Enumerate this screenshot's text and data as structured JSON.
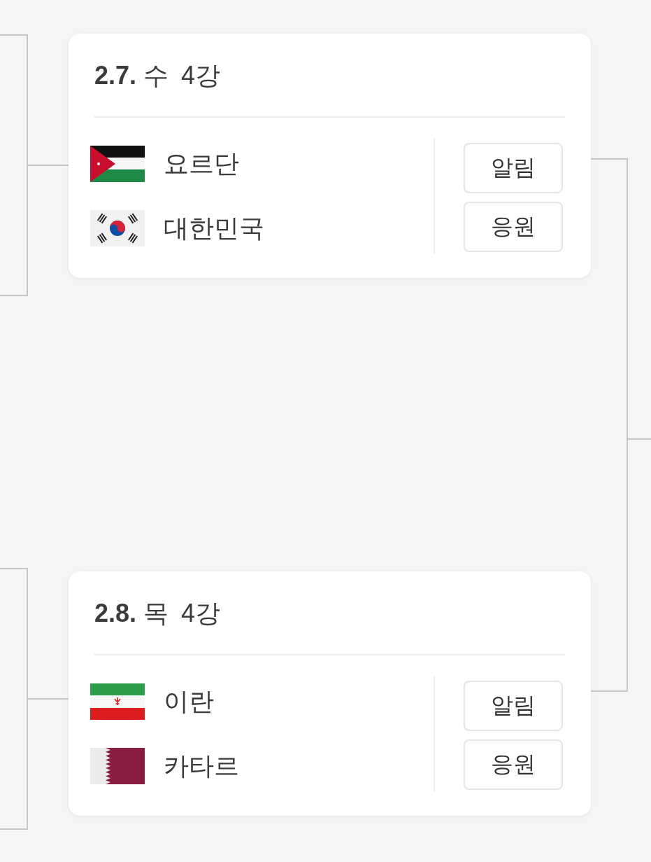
{
  "matches": [
    {
      "date": "**2.7.** 수",
      "round": "4강",
      "teams": [
        {
          "name": "요르단",
          "kind": "jordan"
        },
        {
          "name": "대한민국",
          "kind": "korea"
        }
      ],
      "buttons": [
        "알림",
        "응원"
      ]
    },
    {
      "date": "**2.8.** 목",
      "round": "4강",
      "teams": [
        {
          "name": "이란",
          "kind": "iran"
        },
        {
          "name": "카타르",
          "kind": "qatar"
        }
      ],
      "buttons": [
        "알림",
        "응원"
      ]
    }
  ]
}
